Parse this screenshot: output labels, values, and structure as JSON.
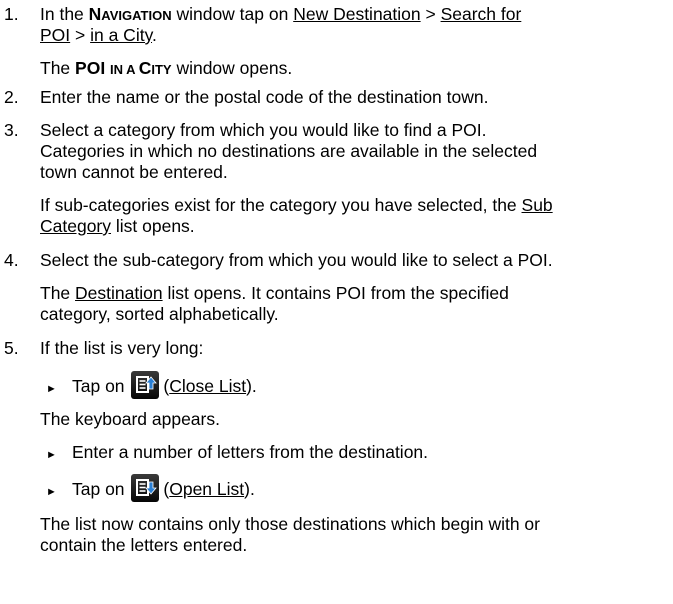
{
  "steps": [
    {
      "number": "1.",
      "line1_pre": "In the ",
      "nav_first": "N",
      "nav_rest": "AVIGATION",
      "line1_mid": " window tap on ",
      "link_new_destination": "New Destination",
      "sep1": " > ",
      "link_search_for": "Search for",
      "link_poi": "POI",
      "sep2": " > ",
      "link_in_a_city": "in a City",
      "period": ".",
      "result_poi": "POI ",
      "result_in_a": "IN A ",
      "result_c": "C",
      "result_ity": "ITY",
      "result_rest": " window opens.",
      "result_the": "The "
    },
    {
      "number": "2.",
      "text": "Enter the name or the postal code of the destination town."
    },
    {
      "number": "3.",
      "line1": "Select a category from which you would like to find a POI.",
      "line2": "Categories in which no destinations are available in the selected",
      "line3": "town cannot be entered.",
      "note_line1_pre": "If sub-categories exist for the category you have selected, the ",
      "note_link_sub": "Sub",
      "note_link_category": "Category",
      "note_line2_rest": " list opens."
    },
    {
      "number": "4.",
      "line1": "Select the sub-category from which you would like to select a POI.",
      "result_pre": "The ",
      "result_link": "Destination",
      "result_rest": " list opens. It contains POI from the specified",
      "result_line2": "category, sorted alphabetically."
    },
    {
      "number": "5.",
      "line1": "If the list is very long:",
      "bullet1_pre": "Tap on ",
      "bullet1_open_paren": "(",
      "bullet1_link": "Close List",
      "bullet1_close": ").",
      "keyboard": "The keyboard appears.",
      "bullet2": "Enter a number of letters from the destination.",
      "bullet3_pre": "Tap on ",
      "bullet3_open_paren": "(",
      "bullet3_link": "Open List",
      "bullet3_close": ").",
      "final_line1": "The list now contains only those destinations which begin with or",
      "final_line2": "contain the letters entered."
    }
  ],
  "icons": {
    "close_list": "close-list-icon",
    "open_list": "open-list-icon",
    "bullet": "triangle-bullet-icon"
  },
  "colors": {
    "icon_bg": "#1a1a1a",
    "icon_fg": "#ffffff",
    "arrow_accent": "#2a7fd4"
  }
}
